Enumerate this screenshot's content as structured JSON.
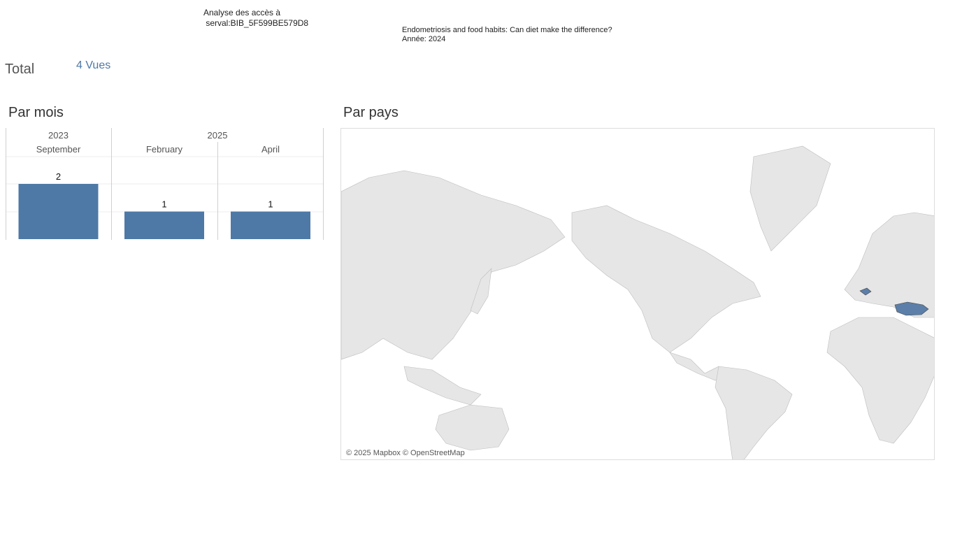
{
  "header": {
    "title": "Analyse des accès à\n serval:BIB_5F599BE579D8",
    "doc_title": "Endometriosis and food habits: Can diet make the difference?",
    "year_line": "Année: 2024"
  },
  "total": {
    "label": "Total",
    "value": "4 Vues"
  },
  "sections": {
    "by_month": "Par mois",
    "by_country": "Par pays"
  },
  "map": {
    "attribution": "© 2025 Mapbox © OpenStreetMap",
    "highlight_color": "#5b7fa8",
    "land_color": "#e6e6e6",
    "highlighted_countries": [
      "Switzerland",
      "Turkey"
    ]
  },
  "chart_data": {
    "type": "bar",
    "groups": [
      {
        "year": "2023",
        "months": [
          "September"
        ]
      },
      {
        "year": "2025",
        "months": [
          "February",
          "April"
        ]
      }
    ],
    "categories": [
      "September",
      "February",
      "April"
    ],
    "values": [
      2,
      1,
      1
    ],
    "ylim": [
      0,
      2
    ],
    "bar_color": "#4e79a7",
    "grid": true
  }
}
